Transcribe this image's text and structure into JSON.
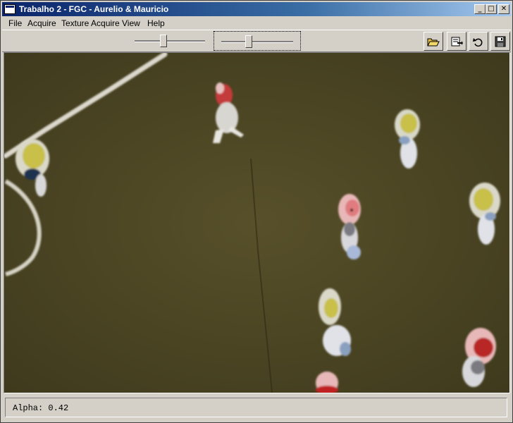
{
  "window": {
    "title": "Trabalho 2 - FGC - Aurelio & Mauricio",
    "controls": {
      "minimize": "_",
      "maximize": "□",
      "close": "✕"
    }
  },
  "menu": [
    "File",
    "Acquire",
    "Texture Acquire",
    "View",
    "Help"
  ],
  "toolbar": {
    "sliders": [
      {
        "name": "slider-1",
        "value_fraction": 0.4
      },
      {
        "name": "slider-2",
        "value_fraction": 0.42
      }
    ],
    "buttons": [
      {
        "icon": "open-folder-icon"
      },
      {
        "icon": "export-icon"
      },
      {
        "icon": "undo-icon"
      },
      {
        "icon": "save-icon"
      }
    ]
  },
  "colors": {
    "title_gradient_start": "#0a246a",
    "title_gradient_end": "#a6caf0",
    "pitch": "#4b4623",
    "face": "#d4d0c8"
  },
  "status": {
    "text": "Alpha: 0.42"
  }
}
